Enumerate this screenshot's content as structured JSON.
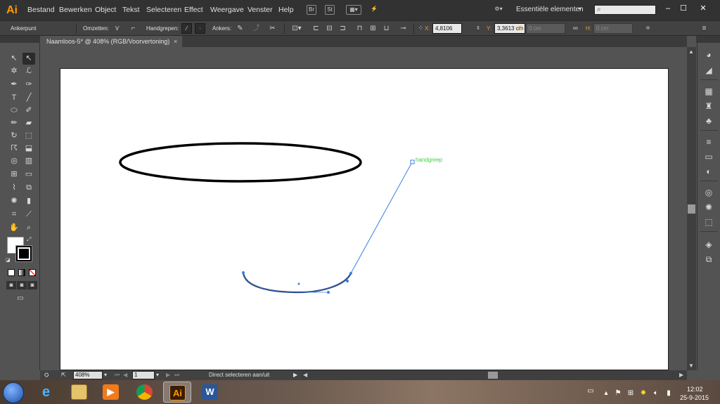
{
  "app": {
    "logo": "Ai",
    "menu": [
      "Bestand",
      "Bewerken",
      "Object",
      "Tekst",
      "Selecteren",
      "Effect",
      "Weergave",
      "Venster",
      "Help"
    ],
    "workspace": "Essentiële elementen",
    "search_placeholder": "",
    "window_controls": [
      "minimize",
      "maximize",
      "close"
    ]
  },
  "control_bar": {
    "label_anchor": "Ankerpunt",
    "label_convert": "Omzetten:",
    "label_handles": "Handgrepen:",
    "label_anchors": "Ankers:",
    "x_label": "X:",
    "x_value": "4,8106 cm",
    "y_label": "Y:",
    "y_value": "3,3613 cm",
    "b_label": "B:",
    "b_value": "0 cm",
    "h_label": "H:",
    "h_value": "0 cm"
  },
  "document": {
    "tab_title": "Naamloos-5* @ 408% (RGB/Voorvertoning)",
    "close": "×"
  },
  "canvas": {
    "smart_guide_label": "handgreep",
    "colors": {
      "path": "#000000",
      "selection": "#3d7fe0",
      "guide": "#3fcf3f",
      "artboard": "#ffffff"
    }
  },
  "status_bar": {
    "zoom": "408%",
    "page": "1",
    "tool_status": "Direct selecteren aan/uit"
  },
  "taskbar": {
    "apps": [
      "start",
      "internet-explorer",
      "file-explorer",
      "media-player",
      "chrome",
      "illustrator",
      "word"
    ],
    "active_app": "illustrator",
    "time": "12:02",
    "date": "25-9-2015"
  }
}
